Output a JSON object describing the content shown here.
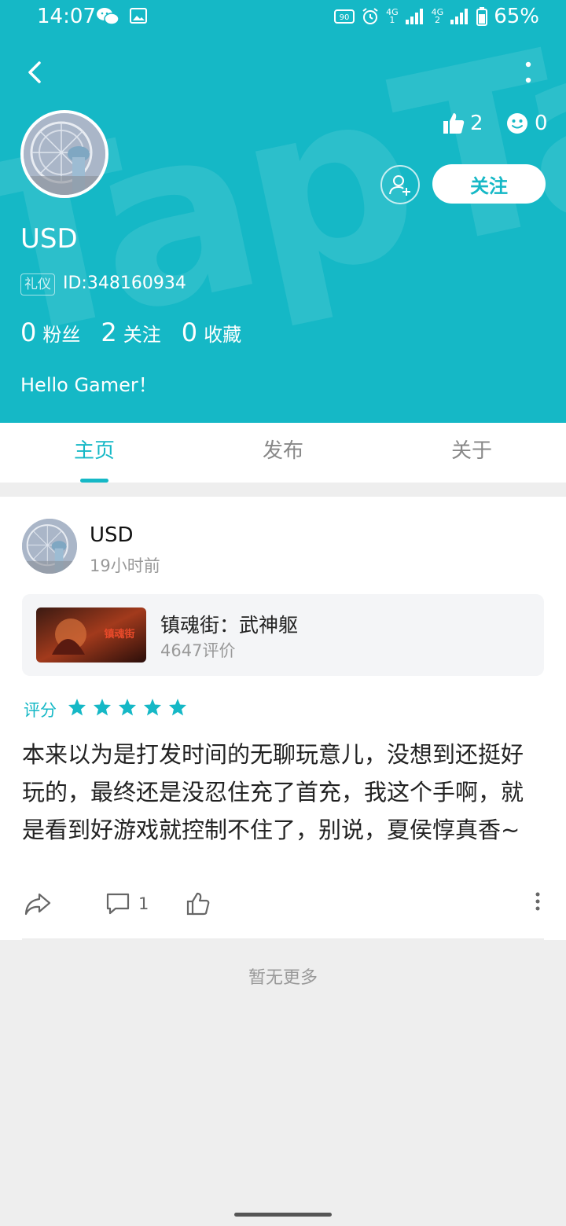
{
  "status_bar": {
    "time": "14:07",
    "battery": "65%",
    "sim1_net": "4G",
    "sim1_slot": "1",
    "sim2_net": "4G",
    "sim2_slot": "2",
    "speed": "90"
  },
  "header": {
    "bg_color": "#15b8c6",
    "likes": "2",
    "smiles": "0",
    "follow_label": "关注",
    "username": "USD",
    "badge": "礼仪",
    "user_id": "ID:348160934",
    "counts": [
      {
        "num": "0",
        "label": "粉丝"
      },
      {
        "num": "2",
        "label": "关注"
      },
      {
        "num": "0",
        "label": "收藏"
      }
    ],
    "bio": "Hello Gamer！"
  },
  "tabs": [
    {
      "label": "主页",
      "active": true
    },
    {
      "label": "发布",
      "active": false
    },
    {
      "label": "关于",
      "active": false
    }
  ],
  "post": {
    "author": "USD",
    "time": "19小时前",
    "game": {
      "title": "镇魂街：武神躯",
      "reviews": "4647评价",
      "thumb_text": "镇魂街"
    },
    "rating_label": "评分",
    "rating": 5,
    "text": "本来以为是打发时间的无聊玩意儿，没想到还挺好玩的，最终还是没忍住充了首充，我这个手啊，就是看到好游戏就控制不住了，别说，夏侯惇真香~",
    "comments": "1"
  },
  "footer": {
    "no_more": "暂无更多"
  }
}
